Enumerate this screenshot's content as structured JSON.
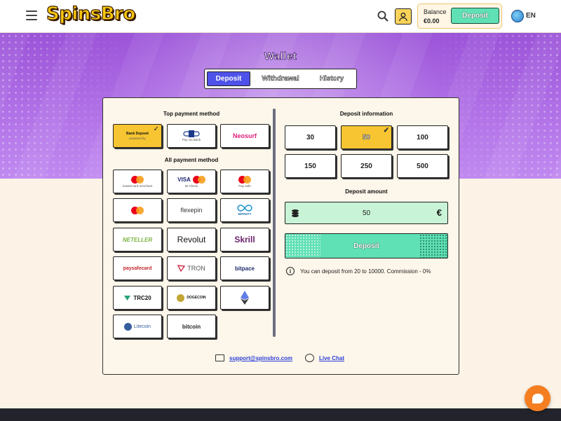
{
  "header": {
    "logo": "SpinsBro",
    "balance_label": "Balance",
    "balance_value": "€0.00",
    "deposit_label": "Deposit",
    "language": "EN"
  },
  "wallet": {
    "title": "Wallet",
    "tabs": [
      {
        "label": "Deposit",
        "active": true
      },
      {
        "label": "Withdrawal",
        "active": false
      },
      {
        "label": "History",
        "active": false
      }
    ]
  },
  "payment": {
    "top_title": "Top payment method",
    "all_title": "All payment method",
    "top_methods": [
      {
        "name": "Bank Deposit",
        "sub": "powered by",
        "selected": true
      },
      {
        "name": "Pay via Bank",
        "selected": false
      },
      {
        "name": "Neosurf",
        "selected": false
      }
    ],
    "methods": [
      {
        "name": "Mastercard",
        "sub": "mastercard merchant"
      },
      {
        "name": "VISA",
        "sub": "ID-Check"
      },
      {
        "name": "Mastercard",
        "sub": "Pay safe"
      },
      {
        "name": "Mastercard",
        "sub": ""
      },
      {
        "name": "flexepin"
      },
      {
        "name": "MiFINITY"
      },
      {
        "name": "NETELLER"
      },
      {
        "name": "Revolut"
      },
      {
        "name": "Skrill"
      },
      {
        "name": "paysafecard"
      },
      {
        "name": "TRON"
      },
      {
        "name": "bitpace"
      },
      {
        "name": "TRC20"
      },
      {
        "name": "DOGECOIN"
      },
      {
        "name": "Ethereum"
      },
      {
        "name": "Litecoin"
      },
      {
        "name": "bitcoin"
      }
    ]
  },
  "deposit": {
    "info_title": "Deposit information",
    "amounts": [
      "30",
      "50",
      "100",
      "150",
      "250",
      "500"
    ],
    "selected_amount": "50",
    "amount_title": "Deposit amount",
    "amount_value": "50",
    "currency": "€",
    "button_label": "Deposit",
    "info_text": "You can deposit from 20 to 10000. Commission - 0%"
  },
  "footer": {
    "support_email": "support@spinsbro.com",
    "live_chat": "Live Chat"
  },
  "colors": {
    "accent": "#4f52e8",
    "gold": "#f7c531",
    "mint": "#5fe0b5",
    "purple": "#9b53d8"
  }
}
